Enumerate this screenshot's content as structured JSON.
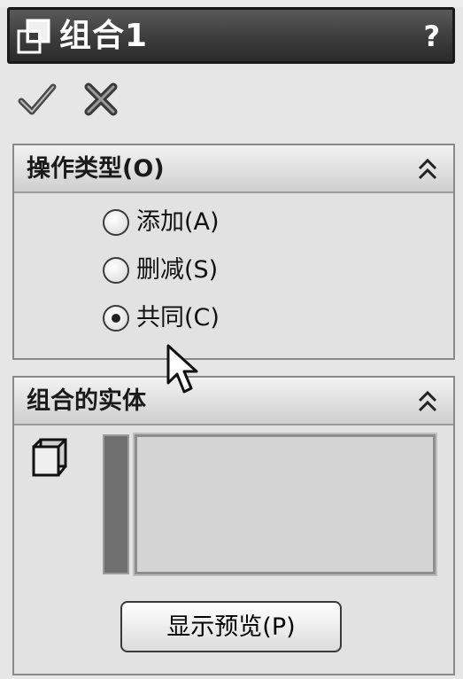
{
  "window": {
    "title": "组合1",
    "help_label": "?"
  },
  "actions": {
    "ok_icon": "checkmark-icon",
    "cancel_icon": "x-icon"
  },
  "operation_type": {
    "header": "操作类型(O)",
    "options": [
      {
        "label": "添加(A)",
        "selected": false
      },
      {
        "label": "删减(S)",
        "selected": false
      },
      {
        "label": "共同(C)",
        "selected": true
      }
    ]
  },
  "bodies_to_combine": {
    "header": "组合的实体",
    "preview_button": "显示预览(P)"
  }
}
